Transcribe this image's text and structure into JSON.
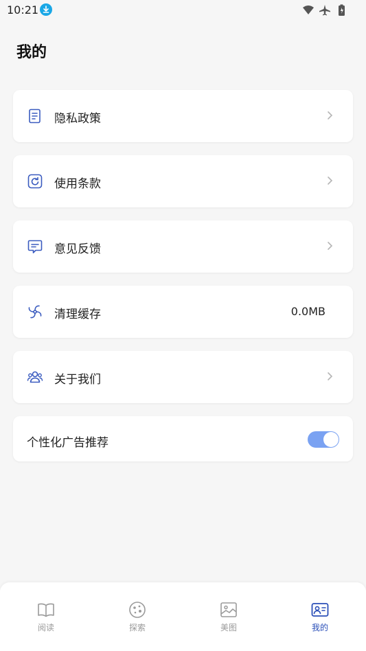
{
  "status_bar": {
    "time": "10:21"
  },
  "page": {
    "title": "我的"
  },
  "menu": {
    "privacy": "隐私政策",
    "terms": "使用条款",
    "feedback": "意见反馈",
    "cache": "清理缓存",
    "cache_size": "0.0MB",
    "about": "关于我们",
    "ads": "个性化广告推荐",
    "ads_enabled": true
  },
  "tabs": [
    {
      "label": "阅读",
      "icon": "book-icon",
      "active": false
    },
    {
      "label": "探索",
      "icon": "explore-icon",
      "active": false
    },
    {
      "label": "美图",
      "icon": "image-icon",
      "active": false
    },
    {
      "label": "我的",
      "icon": "profile-card-icon",
      "active": true
    }
  ],
  "colors": {
    "accent": "#2a4fb8",
    "toggle": "#7aa2f2",
    "icon": "#3a5bbf"
  }
}
